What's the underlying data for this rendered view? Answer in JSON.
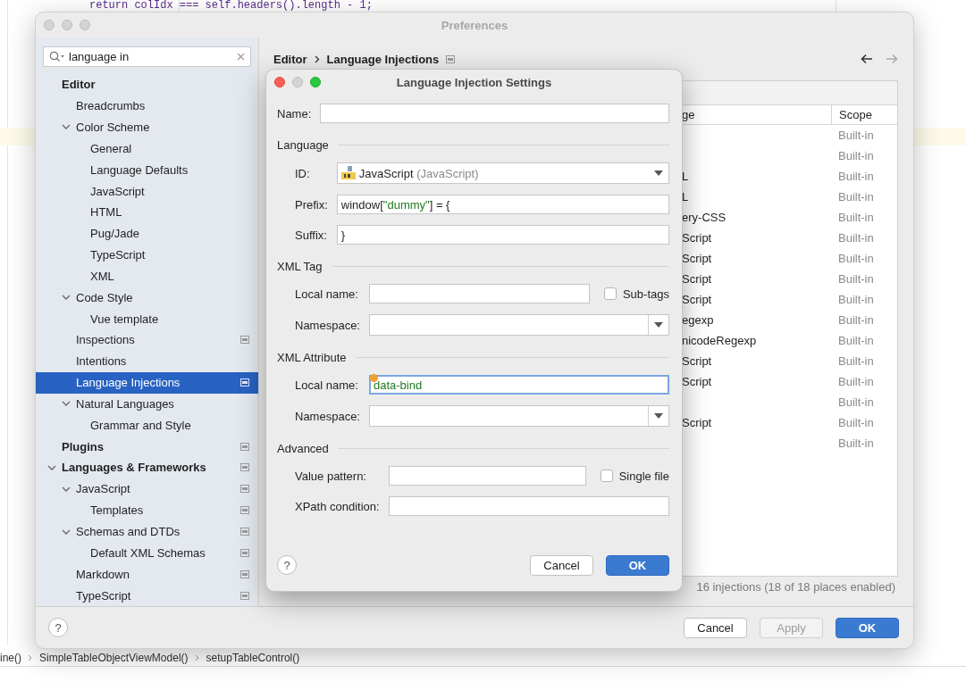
{
  "editor": {
    "code_line": "return colIdx === self.headers().length - 1;",
    "breadcrumbs": [
      "ine()",
      "SimpleTableObjectViewModel()",
      "setupTableControl()"
    ]
  },
  "preferences": {
    "title": "Preferences",
    "search": {
      "value": "language in"
    },
    "tree": [
      {
        "label": "Editor",
        "kind": "section",
        "selected": false,
        "badge": false,
        "children": [
          {
            "label": "Breadcrumbs",
            "kind": "page",
            "selected": false,
            "badge": false
          },
          {
            "label": "Color Scheme",
            "kind": "page",
            "selected": false,
            "badge": false,
            "expanded": true,
            "children": [
              {
                "label": "General",
                "kind": "page",
                "selected": false,
                "badge": false
              },
              {
                "label": "Language Defaults",
                "kind": "page",
                "selected": false,
                "badge": false
              },
              {
                "label": "JavaScript",
                "kind": "page",
                "selected": false,
                "badge": false
              },
              {
                "label": "HTML",
                "kind": "page",
                "selected": false,
                "badge": false
              },
              {
                "label": "Pug/Jade",
                "kind": "page",
                "selected": false,
                "badge": false
              },
              {
                "label": "TypeScript",
                "kind": "page",
                "selected": false,
                "badge": false
              },
              {
                "label": "XML",
                "kind": "page",
                "selected": false,
                "badge": false
              }
            ]
          },
          {
            "label": "Code Style",
            "kind": "page",
            "selected": false,
            "badge": false,
            "expanded": true,
            "children": [
              {
                "label": "Vue template",
                "kind": "page",
                "selected": false,
                "badge": false
              }
            ]
          },
          {
            "label": "Inspections",
            "kind": "page",
            "selected": false,
            "badge": true
          },
          {
            "label": "Intentions",
            "kind": "page",
            "selected": false,
            "badge": false
          },
          {
            "label": "Language Injections",
            "kind": "page",
            "selected": true,
            "badge": true
          },
          {
            "label": "Natural Languages",
            "kind": "page",
            "selected": false,
            "badge": false,
            "expanded": true,
            "children": [
              {
                "label": "Grammar and Style",
                "kind": "page",
                "selected": false,
                "badge": false
              }
            ]
          }
        ]
      },
      {
        "label": "Plugins",
        "kind": "section",
        "selected": false,
        "badge": true
      },
      {
        "label": "Languages & Frameworks",
        "kind": "section",
        "selected": false,
        "badge": true,
        "expanded": true,
        "children": [
          {
            "label": "JavaScript",
            "kind": "page",
            "selected": false,
            "badge": true,
            "expanded": true,
            "children": [
              {
                "label": "Templates",
                "kind": "page",
                "selected": false,
                "badge": true
              }
            ]
          },
          {
            "label": "Schemas and DTDs",
            "kind": "page",
            "selected": false,
            "badge": true,
            "expanded": true,
            "children": [
              {
                "label": "Default XML Schemas",
                "kind": "page",
                "selected": false,
                "badge": true
              }
            ]
          },
          {
            "label": "Markdown",
            "kind": "page",
            "selected": false,
            "badge": true
          },
          {
            "label": "TypeScript",
            "kind": "page",
            "selected": false,
            "badge": true
          }
        ]
      }
    ],
    "breadcrumb": [
      "Editor",
      "Language Injections"
    ],
    "table": {
      "columns": [
        "ge",
        "Scope"
      ],
      "rows": [
        {
          "scope": "Built-in"
        },
        {
          "scope": "Built-in"
        },
        {
          "language": "L",
          "scope": "Built-in"
        },
        {
          "language": "L",
          "scope": "Built-in"
        },
        {
          "language": "ery-CSS",
          "scope": "Built-in"
        },
        {
          "language": "Script",
          "scope": "Built-in"
        },
        {
          "language": "Script",
          "scope": "Built-in"
        },
        {
          "language": "Script",
          "scope": "Built-in"
        },
        {
          "language": "Script",
          "scope": "Built-in"
        },
        {
          "language": "egexp",
          "scope": "Built-in"
        },
        {
          "language": "nicodeRegexp",
          "scope": "Built-in"
        },
        {
          "language": "Script",
          "scope": "Built-in"
        },
        {
          "language": "Script",
          "scope": "Built-in"
        },
        {
          "scope": "Built-in"
        },
        {
          "language": "Script",
          "scope": "Built-in"
        },
        {
          "scope": "Built-in"
        }
      ]
    },
    "status": "16 injections (18 of 18 places enabled)",
    "help": "?",
    "buttons": [
      {
        "label": "Cancel",
        "kind": "default",
        "disabled": false
      },
      {
        "label": "Apply",
        "kind": "default",
        "disabled": true
      },
      {
        "label": "OK",
        "kind": "primary",
        "disabled": false
      }
    ]
  },
  "dialog": {
    "title": "Language Injection Settings",
    "name": {
      "label": "Name:"
    },
    "sections": [
      {
        "title": "Language",
        "rows": [
          {
            "kind": "language_combo",
            "label": "ID:",
            "value": "JavaScript",
            "hint": "(JavaScript)"
          },
          {
            "kind": "text",
            "label": "Prefix:",
            "focused": false,
            "segments": [
              {
                "text": "window[",
                "kind": "plain"
              },
              {
                "text": "\"dummy\"",
                "kind": "string"
              },
              {
                "text": "] = {",
                "kind": "plain"
              }
            ]
          },
          {
            "kind": "text",
            "label": "Suffix:",
            "focused": false,
            "segments": [
              {
                "text": "}",
                "kind": "plain"
              }
            ]
          }
        ]
      },
      {
        "title": "XML Tag",
        "rows": [
          {
            "kind": "text_check",
            "label": "Local name:",
            "check": {
              "label": "Sub-tags",
              "checked": false
            }
          },
          {
            "kind": "combo",
            "label": "Namespace:"
          }
        ]
      },
      {
        "title": "XML Attribute",
        "rows": [
          {
            "kind": "text",
            "label": "Local name:",
            "focused": true,
            "segments": [
              {
                "text": "data-bind",
                "kind": "string"
              }
            ]
          },
          {
            "kind": "combo",
            "label": "Namespace:"
          }
        ]
      },
      {
        "title": "Advanced",
        "rows": [
          {
            "kind": "text_check",
            "label": "Value pattern:",
            "check": {
              "label": "Single file",
              "checked": false
            }
          },
          {
            "kind": "text",
            "label": "XPath condition:",
            "focused": false
          }
        ]
      }
    ],
    "help": "?",
    "buttons": [
      {
        "label": "Cancel",
        "kind": "default",
        "disabled": false
      },
      {
        "label": "OK",
        "kind": "primary",
        "disabled": false
      }
    ]
  }
}
